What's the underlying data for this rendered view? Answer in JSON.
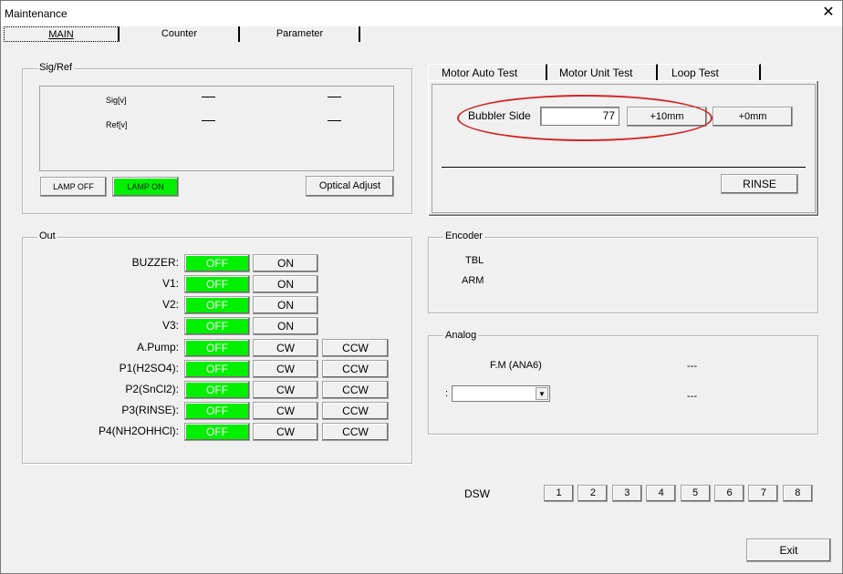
{
  "window": {
    "title": "Maintenance",
    "close": "✕"
  },
  "tabs": [
    "MAIN",
    "Counter",
    "Parameter"
  ],
  "sigref": {
    "title": "Sig/Ref",
    "sig_label": "Sig[v]",
    "ref_label": "Ref[v]",
    "lamp_off": "LAMP OFF",
    "lamp_on": "LAMP ON",
    "optical_adjust": "Optical Adjust"
  },
  "out": {
    "title": "Out",
    "rows": [
      {
        "label": "BUZZER:",
        "off": "OFF",
        "b1": "ON",
        "b2": ""
      },
      {
        "label": "V1:",
        "off": "OFF",
        "b1": "ON",
        "b2": ""
      },
      {
        "label": "V2:",
        "off": "OFF",
        "b1": "ON",
        "b2": ""
      },
      {
        "label": "V3:",
        "off": "OFF",
        "b1": "ON",
        "b2": ""
      },
      {
        "label": "A.Pump:",
        "off": "OFF",
        "b1": "CW",
        "b2": "CCW"
      },
      {
        "label": "P1(H2SO4):",
        "off": "OFF",
        "b1": "CW",
        "b2": "CCW"
      },
      {
        "label": "P2(SnCl2):",
        "off": "OFF",
        "b1": "CW",
        "b2": "CCW"
      },
      {
        "label": "P3(RINSE):",
        "off": "OFF",
        "b1": "CW",
        "b2": "CCW"
      },
      {
        "label": "P4(NH2OHHCl):",
        "off": "OFF",
        "b1": "CW",
        "b2": "CCW"
      }
    ]
  },
  "motor": {
    "tabs": [
      "Motor Auto Test",
      "Motor Unit Test",
      "Loop Test"
    ],
    "bubbler_label": "Bubbler Side",
    "bubbler_value": "77",
    "plus10": "+10mm",
    "plus0": "+0mm",
    "rinse": "RINSE"
  },
  "encoder": {
    "title": "Encoder",
    "tbl": "TBL",
    "arm": "ARM"
  },
  "analog": {
    "title": "Analog",
    "fm_label": "F.M  (ANA6)",
    "fm_value": "---",
    "select_prefix": ":",
    "select_value": "",
    "value2": "---"
  },
  "dsw": {
    "label": "DSW",
    "buttons": [
      "1",
      "2",
      "3",
      "4",
      "5",
      "6",
      "7",
      "8"
    ]
  },
  "exit": "Exit",
  "colors": {
    "green": "#00f000",
    "highlight": "#d22525"
  }
}
